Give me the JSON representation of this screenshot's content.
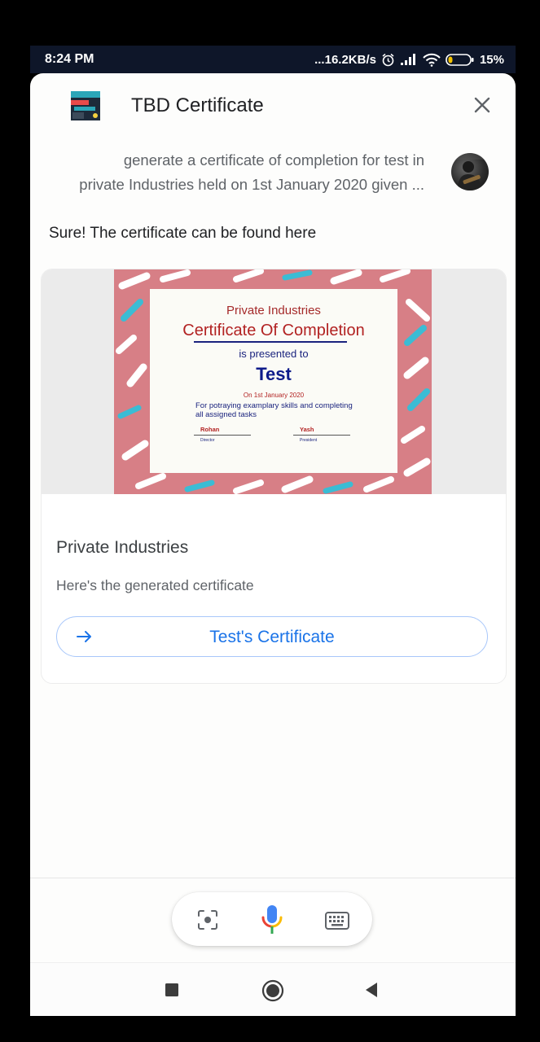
{
  "status_bar": {
    "time": "8:24 PM",
    "network_speed": "...16.2KB/s",
    "battery_percent": "15%",
    "icons": [
      "alarm-icon",
      "signal-icon",
      "wifi-icon",
      "battery-icon"
    ]
  },
  "header": {
    "app_title": "TBD Certificate",
    "icons": [
      "app-logo-icon",
      "close-icon"
    ]
  },
  "query": {
    "line1": "generate a certificate of completion for test in",
    "line2": "private Industries held on 1st January 2020 given ..."
  },
  "reply": {
    "text": "Sure! The certificate can be found here"
  },
  "certificate": {
    "organization": "Private Industries",
    "title": "Certificate Of Completion",
    "presented": "is presented to",
    "recipient": "Test",
    "date": "On 1st January 2020",
    "description": "For potraying examplary skills and completing all assigned tasks",
    "signatory1": {
      "name": "Rohan",
      "role": "Director"
    },
    "signatory2": {
      "name": "Yash",
      "role": "President"
    }
  },
  "card": {
    "title": "Private Industries",
    "subtitle": "Here's the generated certificate",
    "button_label": "Test's Certificate"
  },
  "input_bar": {
    "icons": [
      "lens-icon",
      "microphone-icon",
      "keyboard-icon"
    ]
  },
  "nav_bar": {
    "icons": [
      "recents-icon",
      "home-icon",
      "back-icon"
    ]
  },
  "colors": {
    "status_bar_bg": "#0e1629",
    "accent_blue": "#1a73e8",
    "button_border": "#a8c7fa",
    "certificate_bg": "#d77f86",
    "certificate_title": "#b22222",
    "certificate_name": "#0d1b8a"
  }
}
